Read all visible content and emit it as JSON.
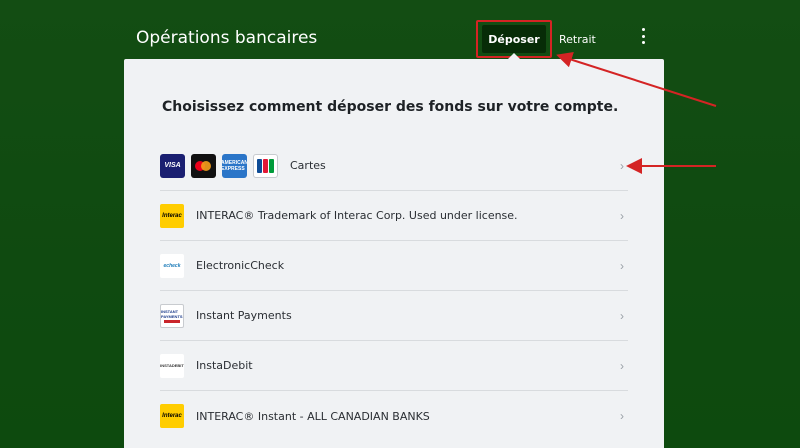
{
  "header": {
    "title": "Opérations bancaires",
    "tabs": [
      {
        "label": "Déposer",
        "active": true
      },
      {
        "label": "Retrait",
        "active": false
      }
    ],
    "menu_icon": "kebab-menu-icon"
  },
  "panel": {
    "heading": "Choisissez comment déposer des fonds sur votre compte.",
    "methods": [
      {
        "label": "Cartes",
        "icons": [
          "visa",
          "mastercard",
          "american-express",
          "jcb"
        ],
        "logo_texts": [
          "VISA",
          "AMERICAN EXPRESS"
        ]
      },
      {
        "label": "INTERAC® Trademark of Interac Corp. Used under license.",
        "icon": "interac",
        "logo_text": "Interac"
      },
      {
        "label": "ElectronicCheck",
        "icon": "echeck",
        "logo_text": "echeck"
      },
      {
        "label": "Instant Payments",
        "icon": "instant-payments",
        "logo_text": "INSTANT PAYMENTS"
      },
      {
        "label": "InstaDebit",
        "icon": "instadebit",
        "logo_text": "INSTADEBIT"
      },
      {
        "label": "INTERAC® Instant - ALL CANADIAN BANKS",
        "icon": "interac",
        "logo_text": "Interac"
      }
    ]
  },
  "colors": {
    "background": "#134d13",
    "active_tab": "#072c07",
    "highlight": "#d42424",
    "panel": "#f0f2f4"
  }
}
